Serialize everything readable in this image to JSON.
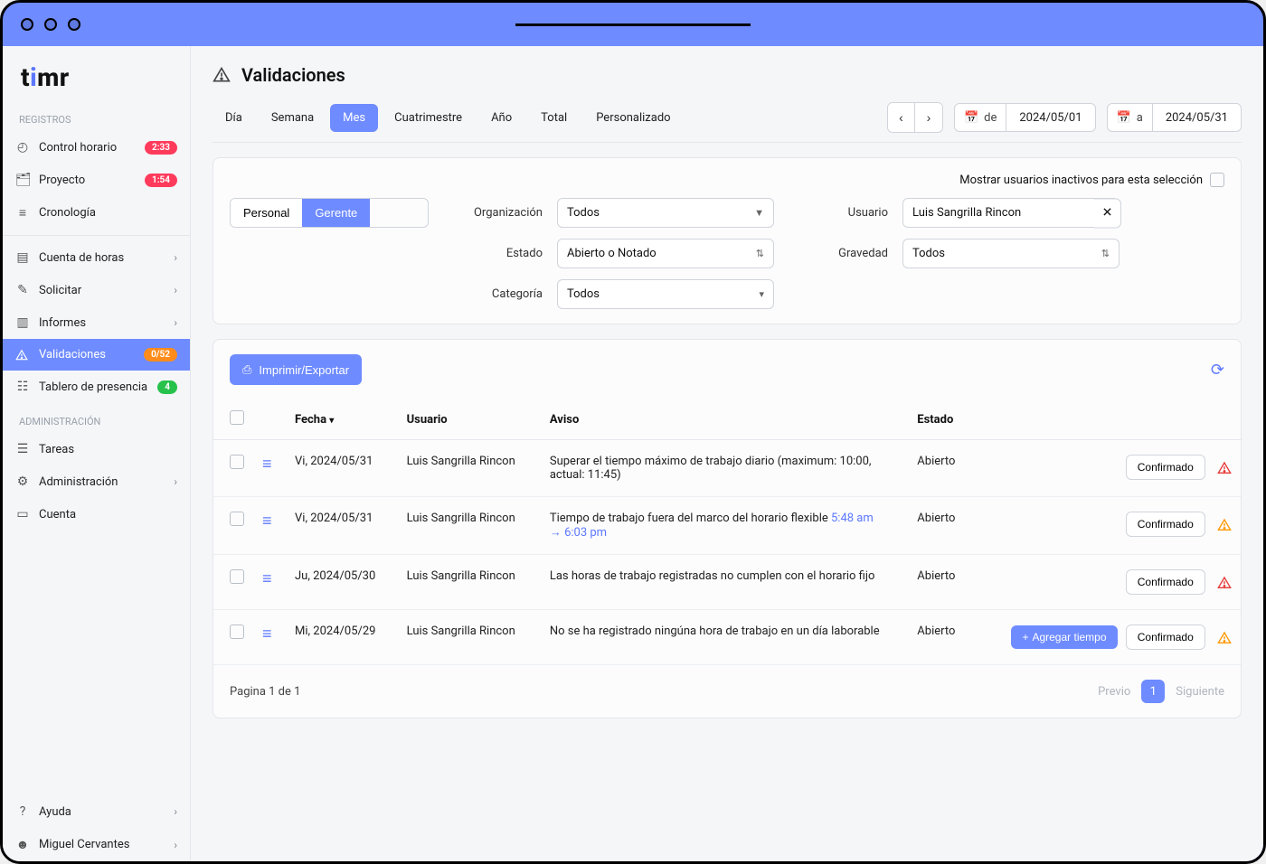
{
  "app": {
    "name_pre": "t",
    "name_i": "i",
    "name_post": "mr"
  },
  "sidebar": {
    "sections": {
      "registros": "REGISTROS",
      "admin": "ADMINISTRACIÓN"
    },
    "items": {
      "control_horario": {
        "label": "Control horario",
        "badge": "2:33"
      },
      "proyecto": {
        "label": "Proyecto",
        "badge": "1:54"
      },
      "cronologia": {
        "label": "Cronología"
      },
      "cuenta_horas": {
        "label": "Cuenta de horas"
      },
      "solicitar": {
        "label": "Solicitar"
      },
      "informes": {
        "label": "Informes"
      },
      "validaciones": {
        "label": "Validaciones",
        "badge": "0/52"
      },
      "tablero": {
        "label": "Tablero de presencia",
        "badge": "4"
      },
      "tareas": {
        "label": "Tareas"
      },
      "administracion": {
        "label": "Administración"
      },
      "cuenta": {
        "label": "Cuenta"
      },
      "ayuda": {
        "label": "Ayuda"
      },
      "user": {
        "label": "Miguel Cervantes"
      }
    }
  },
  "page": {
    "title": "Validaciones"
  },
  "tabs": {
    "dia": "Día",
    "semana": "Semana",
    "mes": "Mes",
    "cuatrimestre": "Cuatrimestre",
    "anio": "Año",
    "total": "Total",
    "personalizado": "Personalizado"
  },
  "daterange": {
    "de": "de",
    "a": "a",
    "from": "2024/05/01",
    "to": "2024/05/31"
  },
  "filters": {
    "inactive_label": "Mostrar usuarios inactivos para esta selección",
    "seg_personal": "Personal",
    "seg_gerente": "Gerente",
    "org_label": "Organización",
    "org_value": "Todos",
    "user_label": "Usuario",
    "user_value": "Luis Sangrilla Rincon",
    "estado_label": "Estado",
    "estado_value": "Abierto o Notado",
    "gravedad_label": "Gravedad",
    "gravedad_value": "Todos",
    "categoria_label": "Categoría",
    "categoria_value": "Todos"
  },
  "toolbar": {
    "print_export": "Imprimir/Exportar"
  },
  "table": {
    "headers": {
      "fecha": "Fecha",
      "usuario": "Usuario",
      "aviso": "Aviso",
      "estado": "Estado"
    },
    "actions": {
      "confirmado": "Confirmado",
      "agregar": "Agregar tiempo"
    },
    "rows": [
      {
        "fecha": "Vi, 2024/05/31",
        "usuario": "Luis Sangrilla Rincon",
        "aviso": "Superar el tiempo máximo de trabajo diario (maximum: 10:00, actual: 11:45)",
        "estado": "Abierto",
        "sev": "red"
      },
      {
        "fecha": "Vi, 2024/05/31",
        "usuario": "Luis Sangrilla Rincon",
        "aviso_pre": "Tiempo de trabajo fuera del marco del horario flexible ",
        "aviso_t1": "5:48 am",
        "aviso_arrow": " → ",
        "aviso_t2": "6:03 pm",
        "estado": "Abierto",
        "sev": "orange"
      },
      {
        "fecha": "Ju, 2024/05/30",
        "usuario": "Luis Sangrilla Rincon",
        "aviso": "Las horas de trabajo registradas no cumplen con el horario fijo",
        "estado": "Abierto",
        "sev": "red"
      },
      {
        "fecha": "Mi, 2024/05/29",
        "usuario": "Luis Sangrilla Rincon",
        "aviso": "No se ha registrado ningúna hora de trabajo en un día laborable",
        "estado": "Abierto",
        "sev": "orange",
        "agregar": true
      }
    ]
  },
  "pagination": {
    "status": "Pagina 1 de 1",
    "prev": "Previo",
    "page": "1",
    "next": "Siguiente"
  }
}
